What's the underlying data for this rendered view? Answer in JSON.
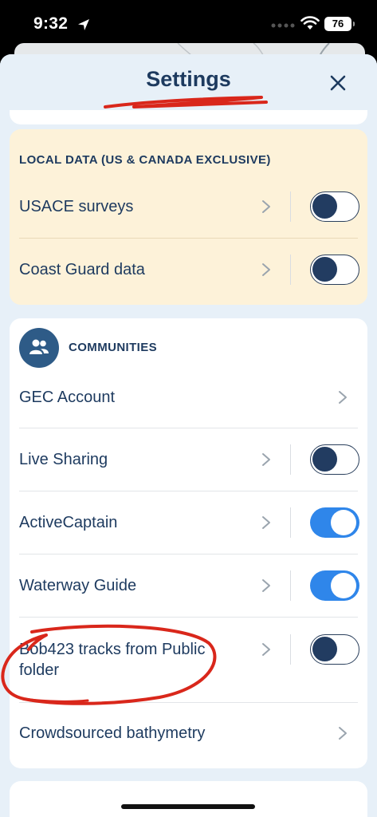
{
  "status_bar": {
    "time": "9:32",
    "battery": "76"
  },
  "header": {
    "title": "Settings",
    "close_icon": "close-icon",
    "annotation_color": "#d9271b"
  },
  "local_data": {
    "section_title": "LOCAL DATA (US & CANADA EXCLUSIVE)",
    "items": [
      {
        "label": "USACE surveys",
        "enabled": false
      },
      {
        "label": "Coast Guard data",
        "enabled": false
      }
    ]
  },
  "communities": {
    "section_title": "COMMUNITIES",
    "icon": "people-icon",
    "items": [
      {
        "label": "GEC Account"
      },
      {
        "label": "Live Sharing",
        "enabled": false
      },
      {
        "label": "ActiveCaptain",
        "enabled": true
      },
      {
        "label": "Waterway Guide",
        "enabled": true
      },
      {
        "label": "Bob423 tracks from Public folder",
        "enabled": false
      },
      {
        "label": "Crowdsourced bathymetry"
      }
    ]
  },
  "colors": {
    "accent_blue": "#2f86ea",
    "navy": "#1d3a5f",
    "local_bg": "#fdf2d9",
    "sheet_bg": "#e7f0f8"
  }
}
